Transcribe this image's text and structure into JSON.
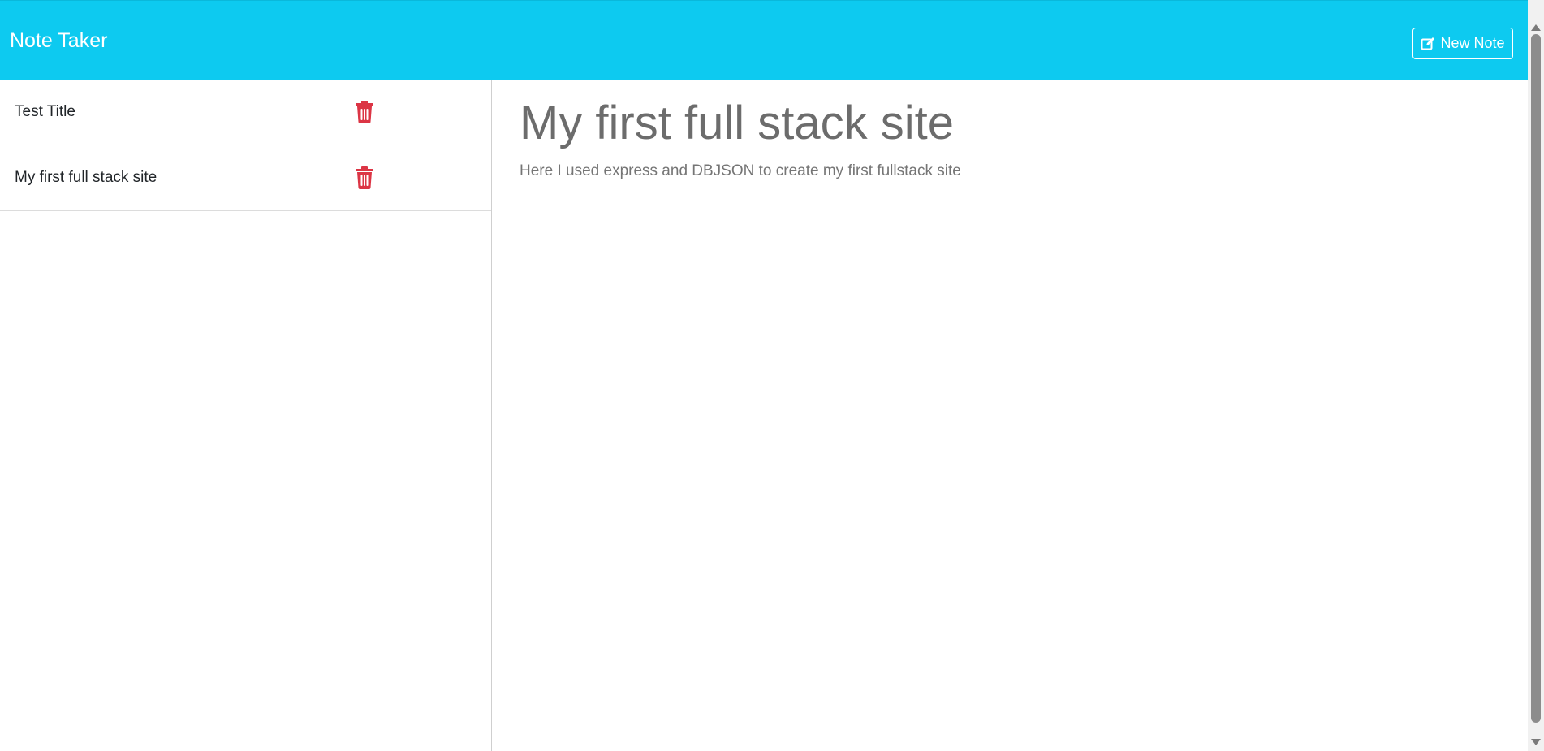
{
  "header": {
    "brand": "Note Taker",
    "new_note_label": "New Note",
    "background_color": "#0dcaf0"
  },
  "sidebar": {
    "notes": [
      {
        "title": "Test Title",
        "delete_icon": "trash-icon"
      },
      {
        "title": "My first full stack site",
        "delete_icon": "trash-icon"
      }
    ],
    "delete_icon_color": "#dc3545"
  },
  "editor": {
    "title": "My first full stack site",
    "text": "Here I used express and DBJSON to create my first fullstack site"
  }
}
